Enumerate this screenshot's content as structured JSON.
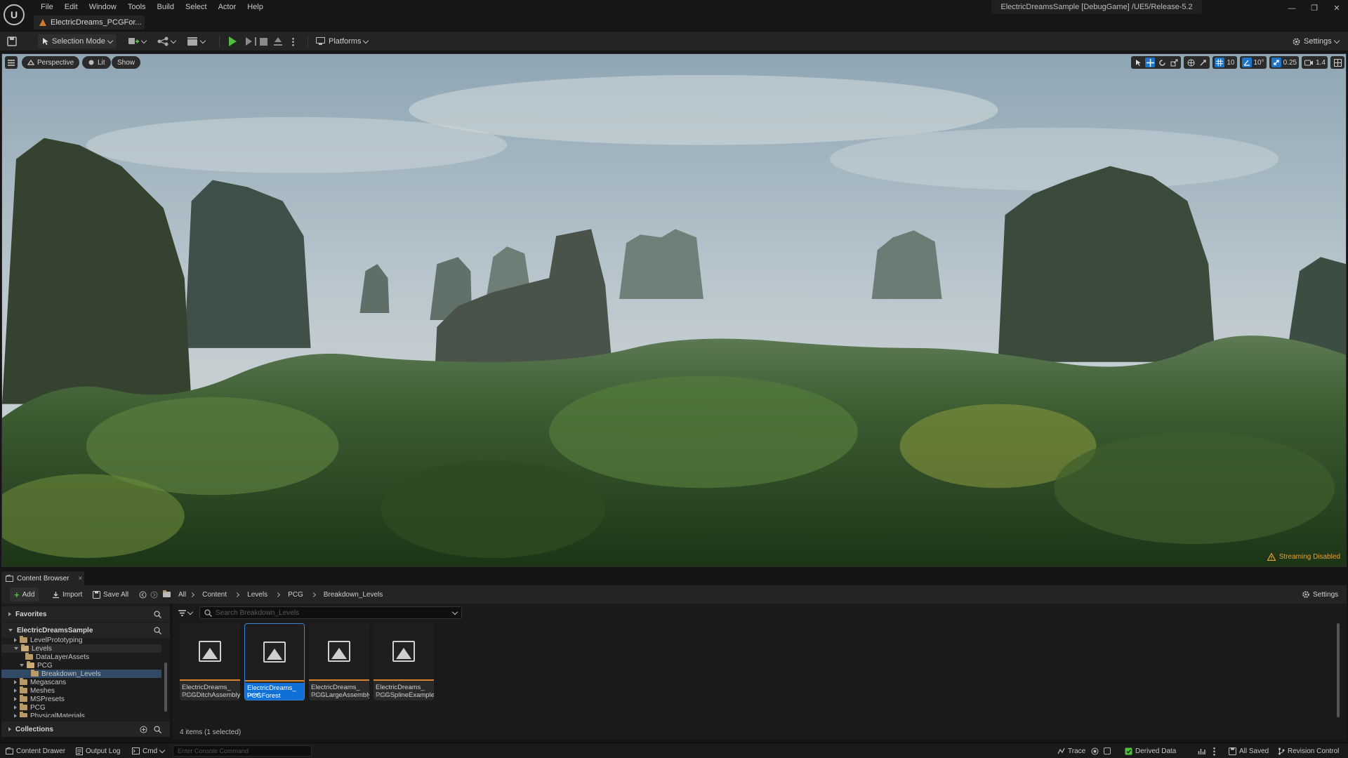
{
  "menu": [
    "File",
    "Edit",
    "Window",
    "Tools",
    "Build",
    "Select",
    "Actor",
    "Help"
  ],
  "level_tab": "ElectricDreams_PCGFor...",
  "project_title": "ElectricDreamsSample [DebugGame] /UE5/Release-5.2",
  "toolbar": {
    "selection_mode": "Selection Mode",
    "platforms": "Platforms",
    "settings": "Settings"
  },
  "viewport": {
    "perspective": "Perspective",
    "lit": "Lit",
    "show": "Show",
    "grid_snap": "10",
    "rotation_snap": "10°",
    "scale_snap": "0.25",
    "camera_speed": "1.4",
    "streaming_status": "Streaming Disabled"
  },
  "content_browser": {
    "tab_label": "Content Browser",
    "add": "Add",
    "import": "Import",
    "save_all": "Save All",
    "settings": "Settings",
    "breadcrumbs": [
      "All",
      "Content",
      "Levels",
      "PCG",
      "Breakdown_Levels"
    ],
    "favorites": "Favorites",
    "project_root": "ElectricDreamsSample",
    "collections": "Collections",
    "tree": [
      {
        "label": "LevelPrototyping",
        "indent": 1,
        "expander": "right"
      },
      {
        "label": "Levels",
        "indent": 1,
        "expander": "down"
      },
      {
        "label": "DataLayerAssets",
        "indent": 2,
        "expander": "none"
      },
      {
        "label": "PCG",
        "indent": 2,
        "expander": "down"
      },
      {
        "label": "Breakdown_Levels",
        "indent": 3,
        "expander": "none",
        "selected": true
      },
      {
        "label": "Megascans",
        "indent": 1,
        "expander": "right"
      },
      {
        "label": "Meshes",
        "indent": 1,
        "expander": "right"
      },
      {
        "label": "MSPresets",
        "indent": 1,
        "expander": "right"
      },
      {
        "label": "PCG",
        "indent": 1,
        "expander": "right"
      },
      {
        "label": "PhysicalMaterials",
        "indent": 1,
        "expander": "right"
      }
    ],
    "search_placeholder": "Search Breakdown_Levels",
    "assets": [
      {
        "line1": "ElectricDreams_",
        "line2": "PCGDitchAssembly",
        "type": "Level",
        "selected": false
      },
      {
        "line1": "ElectricDreams_",
        "line2": "PCGForest",
        "type": "Level",
        "selected": true
      },
      {
        "line1": "ElectricDreams_",
        "line2": "PCGLargeAssembly",
        "type": "Level",
        "selected": false
      },
      {
        "line1": "ElectricDreams_",
        "line2": "PCGSplineExample",
        "type": "Level",
        "selected": false
      }
    ],
    "item_count": "4 items (1 selected)"
  },
  "statusbar": {
    "content_drawer": "Content Drawer",
    "output_log": "Output Log",
    "cmd": "Cmd",
    "console_placeholder": "Enter Console Command",
    "trace": "Trace",
    "derived_data": "Derived Data",
    "all_saved": "All Saved",
    "revision_control": "Revision Control"
  },
  "colors": {
    "accent_blue": "#0f70d8",
    "play_green": "#4fbf3d",
    "warning_orange": "#e8a030",
    "level_orange": "#d9822b"
  }
}
